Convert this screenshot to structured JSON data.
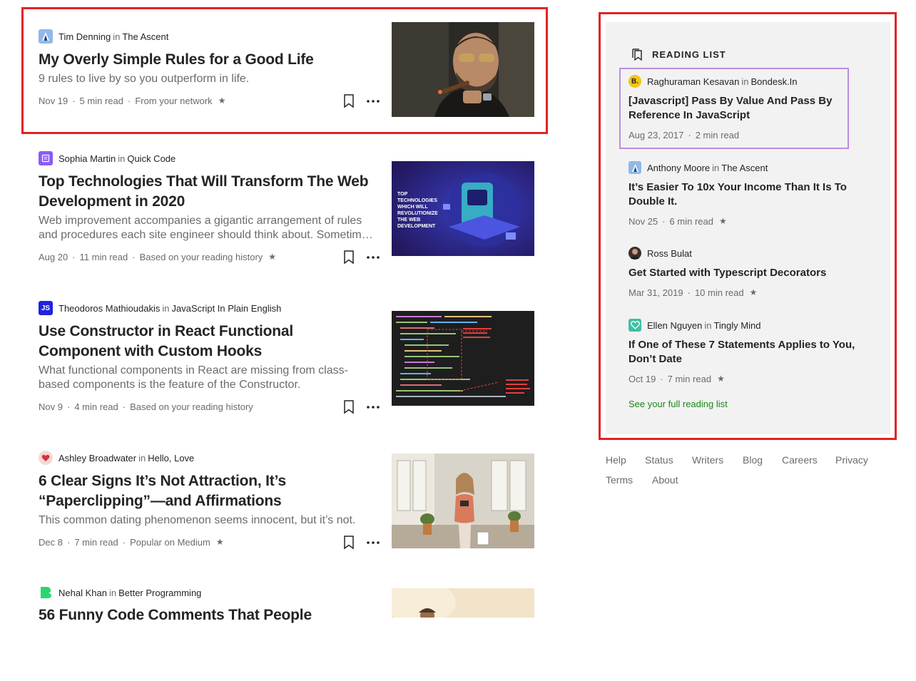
{
  "feed": {
    "articles": [
      {
        "author": "Tim Denning",
        "in_word": "in",
        "publication": "The Ascent",
        "title": "My Overly Simple Rules for a Good Life",
        "subtitle": "9 rules to live by so you outperform in life.",
        "date": "Nov 19",
        "read_time": "5 min read",
        "reason": "From your network",
        "star": "★"
      },
      {
        "author": "Sophia Martin",
        "in_word": "in",
        "publication": "Quick Code",
        "title": "Top Technologies That Will Transform The Web Development in 2020",
        "subtitle": "Web improvement accompanies a gigantic arrangement of rules and procedures each site engineer should think about. Sometimes there is confusion about what to learn.",
        "date": "Aug 20",
        "read_time": "11 min read",
        "reason": "Based on your reading history",
        "star": "★",
        "image_text": "TOP TECHNOLOGIES WHICH WILL REVOLUTIONIZE THE WEB DEVELOPMENT"
      },
      {
        "author": "Theodoros Mathioudakis",
        "in_word": "in",
        "publication": "JavaScript In Plain English",
        "publication_icon_text": "JS",
        "title": "Use Constructor in React Functional Component with Custom Hooks",
        "subtitle": "What functional components in React are missing from class-based components is the feature of the Constructor.",
        "date": "Nov 9",
        "read_time": "4 min read",
        "reason": "Based on your reading history"
      },
      {
        "author": "Ashley Broadwater",
        "in_word": "in",
        "publication": "Hello, Love",
        "title": "6 Clear Signs It’s Not Attraction, It’s “Paperclipping”—and Affirmations",
        "subtitle": "This common dating phenomenon seems innocent, but it’s not.",
        "date": "Dec 8",
        "read_time": "7 min read",
        "reason": "Popular on Medium",
        "star": "★"
      },
      {
        "author": "Nehal Khan",
        "in_word": "in",
        "publication": "Better Programming",
        "title": "56 Funny Code Comments That People"
      }
    ]
  },
  "reading_list": {
    "header": "READING LIST",
    "items": [
      {
        "avatar_text": "B.",
        "author": "Raghuraman Kesavan",
        "in_word": "in",
        "publication": "Bondesk.In",
        "title": "[Javascript] Pass By Value And Pass By Reference In JavaScript",
        "date": "Aug 23, 2017",
        "read_time": "2 min read"
      },
      {
        "author": "Anthony Moore",
        "in_word": "in",
        "publication": "The Ascent",
        "title": "It’s Easier To 10x Your Income Than It Is To Double It.",
        "date": "Nov 25",
        "read_time": "6 min read",
        "star": "★"
      },
      {
        "author": "Ross Bulat",
        "title": "Get Started with Typescript Decorators",
        "date": "Mar 31, 2019",
        "read_time": "10 min read",
        "star": "★"
      },
      {
        "author": "Ellen Nguyen",
        "in_word": "in",
        "publication": "Tingly Mind",
        "title": "If One of These 7 Statements Applies to You, Don’t Date",
        "date": "Oct 19",
        "read_time": "7 min read",
        "star": "★"
      }
    ],
    "see_full": "See your full reading list"
  },
  "footer": {
    "links": [
      "Help",
      "Status",
      "Writers",
      "Blog",
      "Careers",
      "Privacy",
      "Terms",
      "About"
    ]
  },
  "colors": {
    "highlight_red": "#e02323",
    "highlight_purple": "#b98ee0",
    "accent_green": "#1a8917",
    "sidebar_bg": "#f2f2f2",
    "muted_text": "#6b6b6b"
  }
}
